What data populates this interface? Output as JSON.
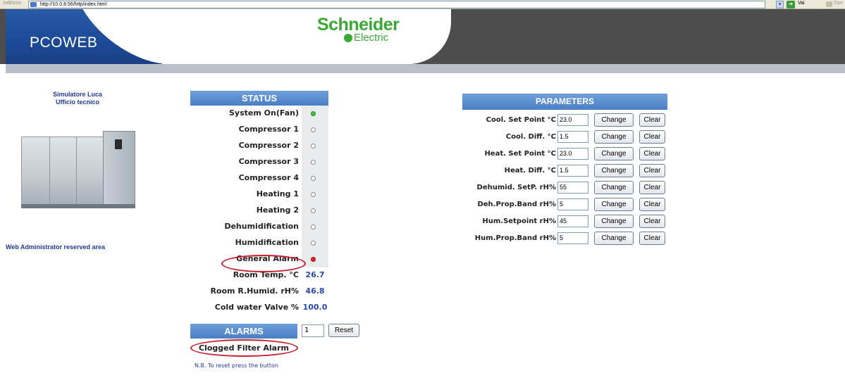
{
  "browser": {
    "address_label": "Indirizzo",
    "url": "http://10.0.8.56/http/index.html",
    "go_label": "Vai",
    "links_label": "Ope"
  },
  "header": {
    "title": "PCOWEB",
    "brand_top": "Schneider",
    "brand_bottom": "Electric"
  },
  "left": {
    "site_name_line1": "Simulatore Luca",
    "site_name_line2": "Ufficio tecnico",
    "admin_link": "Web Administrator reserved area"
  },
  "status": {
    "title": "STATUS",
    "rows": [
      {
        "label": "System On(Fan)",
        "led": "green"
      },
      {
        "label": "Compressor 1",
        "led": "off"
      },
      {
        "label": "Compressor 2",
        "led": "off"
      },
      {
        "label": "Compressor 3",
        "led": "off"
      },
      {
        "label": "Compressor 4",
        "led": "off"
      },
      {
        "label": "Heating 1",
        "led": "off"
      },
      {
        "label": "Heating 2",
        "led": "off"
      },
      {
        "label": "Dehumidification",
        "led": "off"
      },
      {
        "label": "Humidification",
        "led": "off"
      },
      {
        "label": "General Alarm",
        "led": "red"
      },
      {
        "label": "Room Temp. °C",
        "value": "26.7"
      },
      {
        "label": "Room R.Humid. rH%",
        "value": "46.8"
      },
      {
        "label": "Cold water Valve %",
        "value": "100.0"
      }
    ]
  },
  "alarms": {
    "title": "ALARMS",
    "count": "1",
    "reset_label": "Reset",
    "active_alarm": "Clogged Filter Alarm",
    "note": "N.B. To reset press the button"
  },
  "parameters": {
    "title": "PARAMETERS",
    "change_label": "Change",
    "clear_label": "Clear",
    "rows": [
      {
        "label": "Cool. Set Point °C",
        "value": "23.0"
      },
      {
        "label": "Cool. Diff. °C",
        "value": "1.5"
      },
      {
        "label": "Heat. Set Point °C",
        "value": "23.0"
      },
      {
        "label": "Heat. Diff. °C",
        "value": "1.5"
      },
      {
        "label": "Dehumid. SetP. rH%",
        "value": "55"
      },
      {
        "label": "Deh.Prop.Band rH%",
        "value": "5"
      },
      {
        "label": "Hum.Setpoint rH%",
        "value": "45"
      },
      {
        "label": "Hum.Prop.Band rH%",
        "value": "5"
      }
    ]
  },
  "colors": {
    "header_blue": "#1c4a96",
    "panel_blue": "#4a7fc6",
    "brand_green": "#3aa835",
    "alarm_red": "#c81e2e"
  }
}
